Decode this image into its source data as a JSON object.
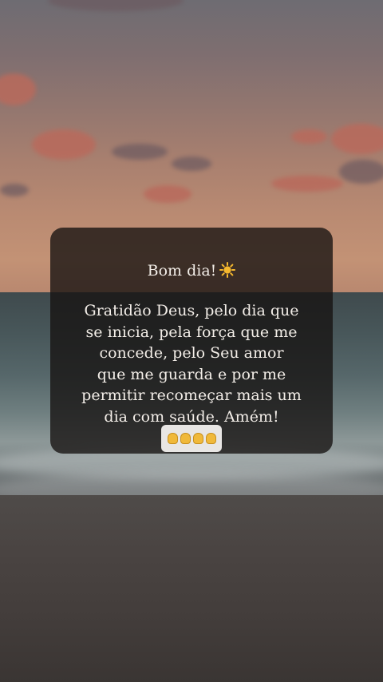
{
  "post": {
    "greeting": "Bom dia!",
    "greeting_icon": "sun-emoji-icon",
    "message_lines": [
      "Gratidão Deus, pelo dia que",
      "se inicia, pela força que me",
      "concede, pelo Seu amor",
      "que me guarda e por me",
      "permitir recomeçar mais um",
      "dia com saúde. Amém!"
    ],
    "footer_icon": "raising-hands-emoji-icon"
  },
  "colors": {
    "card_bg": "#161211",
    "text": "#f3eee8",
    "sun": "#f5b82e"
  }
}
